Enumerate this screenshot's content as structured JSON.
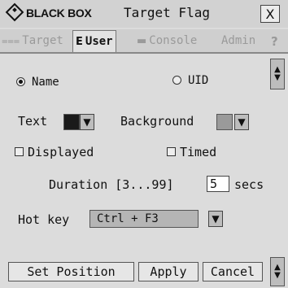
{
  "titlebar": {
    "logo_text": "BLACK BOX",
    "title": "Target Flag",
    "close_symbol": "X"
  },
  "tabs": [
    {
      "label": "Target",
      "icon": "target-tab-icon",
      "active": false
    },
    {
      "label": "User",
      "icon": "user-tab-icon",
      "active": true
    },
    {
      "label": "Console",
      "icon": "console-tab-icon",
      "active": false
    },
    {
      "label": "Admin",
      "icon": "",
      "active": false
    }
  ],
  "help_symbol": "?",
  "display_mode": {
    "options": [
      "Name",
      "UID"
    ],
    "selected": "Name"
  },
  "colors": {
    "text_label": "Text",
    "text_color": "#1a1a1a",
    "background_label": "Background",
    "background_color": "#9a9a9a"
  },
  "flags": {
    "displayed_label": "Displayed",
    "displayed_checked": false,
    "timed_label": "Timed",
    "timed_checked": false
  },
  "duration": {
    "label": "Duration [3...99]",
    "value": "5",
    "unit": "secs"
  },
  "hotkey": {
    "label": "Hot key",
    "value": "Ctrl + F3"
  },
  "buttons": {
    "set_position": "Set Position",
    "apply": "Apply",
    "cancel": "Cancel"
  }
}
